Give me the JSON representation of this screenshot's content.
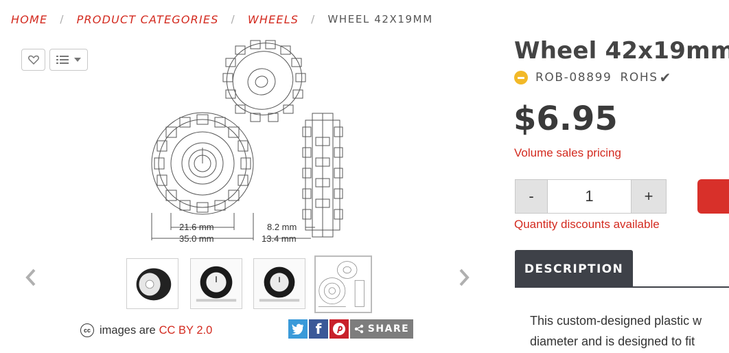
{
  "breadcrumb": {
    "items": [
      "HOME",
      "PRODUCT CATEGORIES",
      "WHEELS"
    ],
    "current": "WHEEL 42X19MM",
    "separator": "/"
  },
  "gallery": {
    "main_image_labels": {
      "inner_dia": "21.6 mm",
      "outer_dia": "35.0 mm",
      "hub_width": "8.2 mm",
      "total_width": "13.4 mm"
    },
    "thumbnails": [
      "wheel-angle-photo",
      "wheel-front-photo",
      "wheel-side-photo",
      "wheel-diagram"
    ],
    "active_thumbnail": 3,
    "license_text": "images are",
    "license_link": "CC BY 2.0"
  },
  "share": {
    "label": "SHARE"
  },
  "product": {
    "title": "Wheel 42x19mm",
    "sku": "ROB-08899",
    "rohs": "ROHS",
    "price": "$6.95",
    "volume_link": "Volume sales pricing",
    "qty_minus": "-",
    "qty_value": "1",
    "qty_plus": "+",
    "qty_discount": "Quantity discounts available"
  },
  "tabs": {
    "description": "DESCRIPTION"
  },
  "description": {
    "line1": "This custom-designed plastic w",
    "line2": "diameter and is designed to fit"
  },
  "colors": {
    "accent_red": "#d32a1f",
    "tab_dark": "#3e4148",
    "stock_yellow": "#f2b928"
  }
}
